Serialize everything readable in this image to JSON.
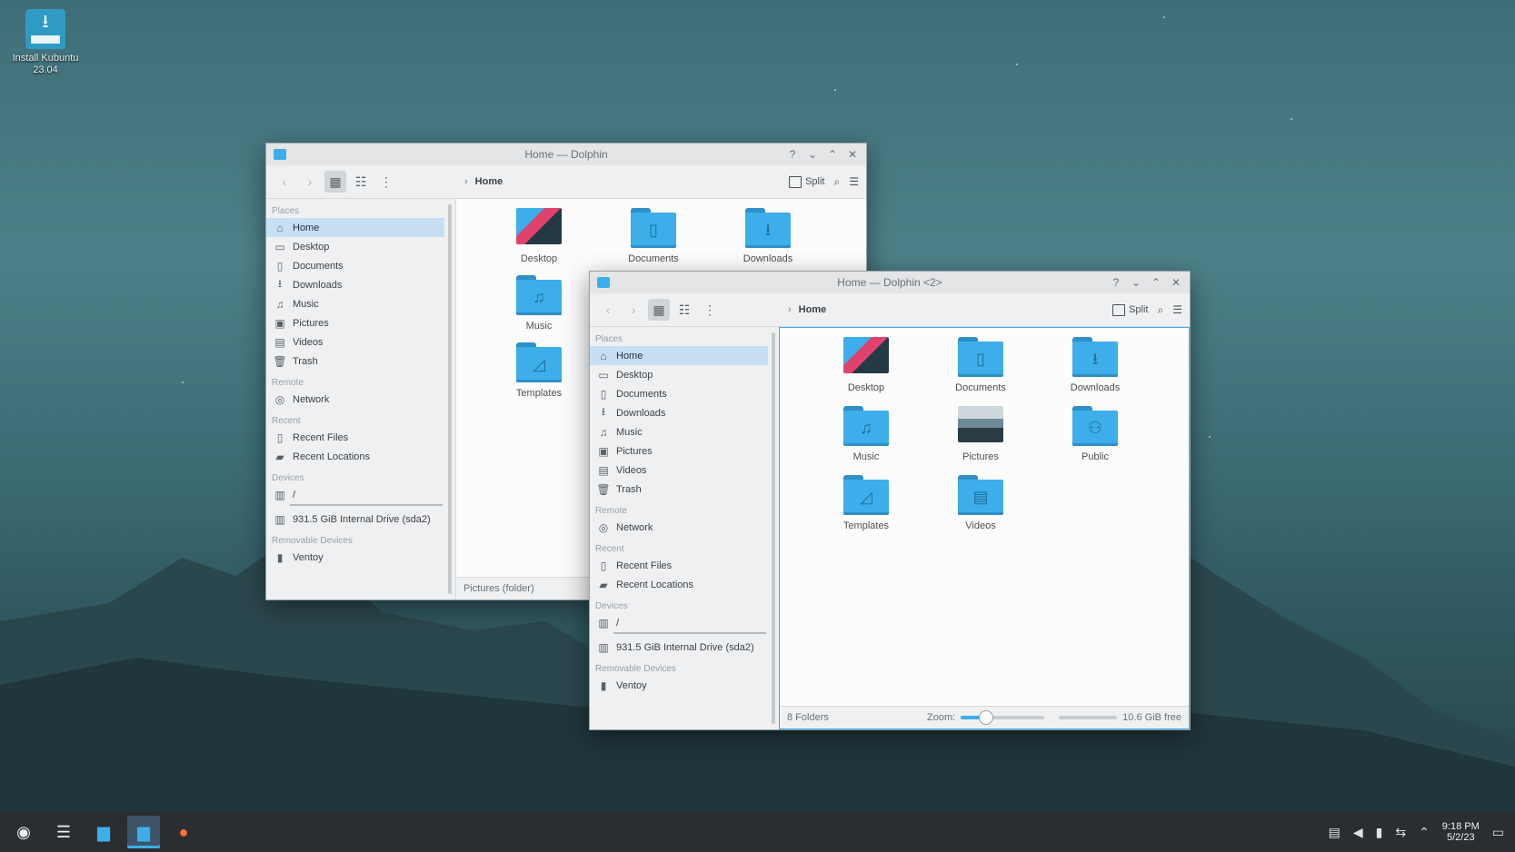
{
  "desktop": {
    "icon": {
      "label": "Install Kubuntu 23.04",
      "icon": "download-installer-icon"
    }
  },
  "window_back": {
    "title": "Home — Dolphin",
    "breadcrumb": "Home",
    "split_label": "Split",
    "sidebar": {
      "sections": {
        "places": "Places",
        "remote": "Remote",
        "recent": "Recent",
        "devices": "Devices",
        "removable": "Removable Devices"
      },
      "places": [
        "Home",
        "Desktop",
        "Documents",
        "Downloads",
        "Music",
        "Pictures",
        "Videos",
        "Trash"
      ],
      "remote": [
        "Network"
      ],
      "recent": [
        "Recent Files",
        "Recent Locations"
      ],
      "devices": [
        "/",
        "931.5 GiB Internal Drive (sda2)"
      ],
      "removable": [
        "Ventoy"
      ]
    },
    "files": [
      "Desktop",
      "Documents",
      "Downloads",
      "Music",
      "Templates"
    ],
    "status": "Pictures (folder)"
  },
  "window_front": {
    "title": "Home — Dolphin <2>",
    "breadcrumb": "Home",
    "split_label": "Split",
    "sidebar": {
      "sections": {
        "places": "Places",
        "remote": "Remote",
        "recent": "Recent",
        "devices": "Devices",
        "removable": "Removable Devices"
      },
      "places": [
        "Home",
        "Desktop",
        "Documents",
        "Downloads",
        "Music",
        "Pictures",
        "Videos",
        "Trash"
      ],
      "remote": [
        "Network"
      ],
      "recent": [
        "Recent Files",
        "Recent Locations"
      ],
      "devices": [
        "/",
        "931.5 GiB Internal Drive (sda2)"
      ],
      "removable": [
        "Ventoy"
      ]
    },
    "files": [
      "Desktop",
      "Documents",
      "Downloads",
      "Music",
      "Pictures",
      "Public",
      "Templates",
      "Videos"
    ],
    "status": {
      "folders": "8 Folders",
      "zoom_label": "Zoom:",
      "free": "10.6 GiB free"
    }
  },
  "taskbar": {
    "clock_time": "9:18 PM",
    "clock_date": "5/2/23"
  },
  "colors": {
    "accent": "#3daee9",
    "selection": "#c6dff2",
    "taskbar": "#2a2e32"
  }
}
